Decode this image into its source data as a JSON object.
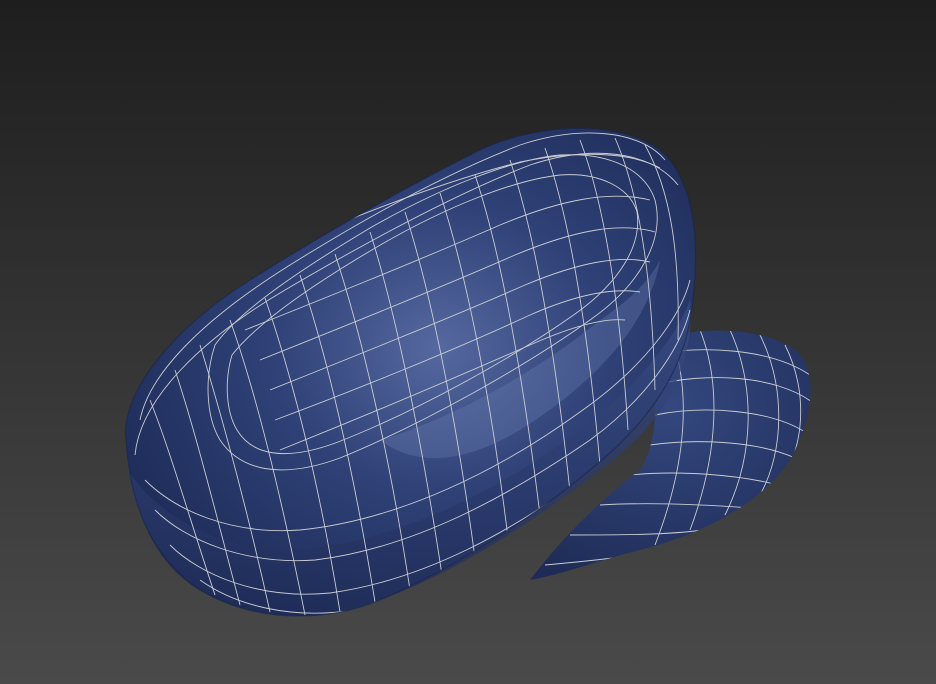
{
  "viewport": {
    "background_top": "#1e1e1e",
    "background_bottom": "#4a4a4a"
  },
  "model": {
    "object": "newsboy-cap",
    "display_mode": "shaded-with-wireframe",
    "fabric_color": "#2f4177",
    "fabric_shadow": "#1c2a55",
    "fabric_highlight": "#5569a0",
    "wire_color": "#c9ccd2"
  }
}
